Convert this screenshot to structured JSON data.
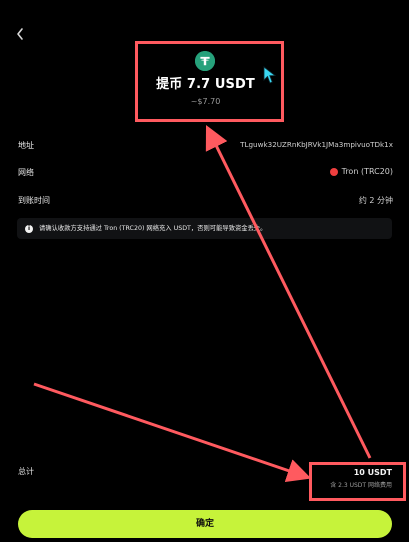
{
  "header": {
    "title": "提币 7.7 USDT",
    "subtitle": "~$7.70"
  },
  "details": {
    "address_label": "地址",
    "address_value": "TLguwk32UZRnKbJRVk1JMa3mpivuoTDk1x",
    "network_label": "网络",
    "network_value": "Tron (TRC20)",
    "arrival_label": "到账时间",
    "arrival_value": "约 2 分钟"
  },
  "notice": {
    "text": "请确认收款方支持通过 Tron (TRC20) 网络充入 USDT，否则可能导致资金丢失。"
  },
  "summary": {
    "total_label": "总计",
    "total_value": "10 USDT",
    "fee_note": "含 2.3 USDT 网络费用"
  },
  "actions": {
    "confirm_label": "确定"
  },
  "icons": {
    "back": "back-arrow-icon",
    "token": "usdt-token-icon",
    "network": "tron-network-icon",
    "info": "info-icon",
    "cursor": "mouse-cursor-icon"
  },
  "colors": {
    "background": "#000000",
    "accent": "#c6f33a",
    "token": "#26a17b",
    "tron": "#ef3f3f",
    "annotation": "#ff5a5f",
    "cursor": "#3ad7f2"
  }
}
